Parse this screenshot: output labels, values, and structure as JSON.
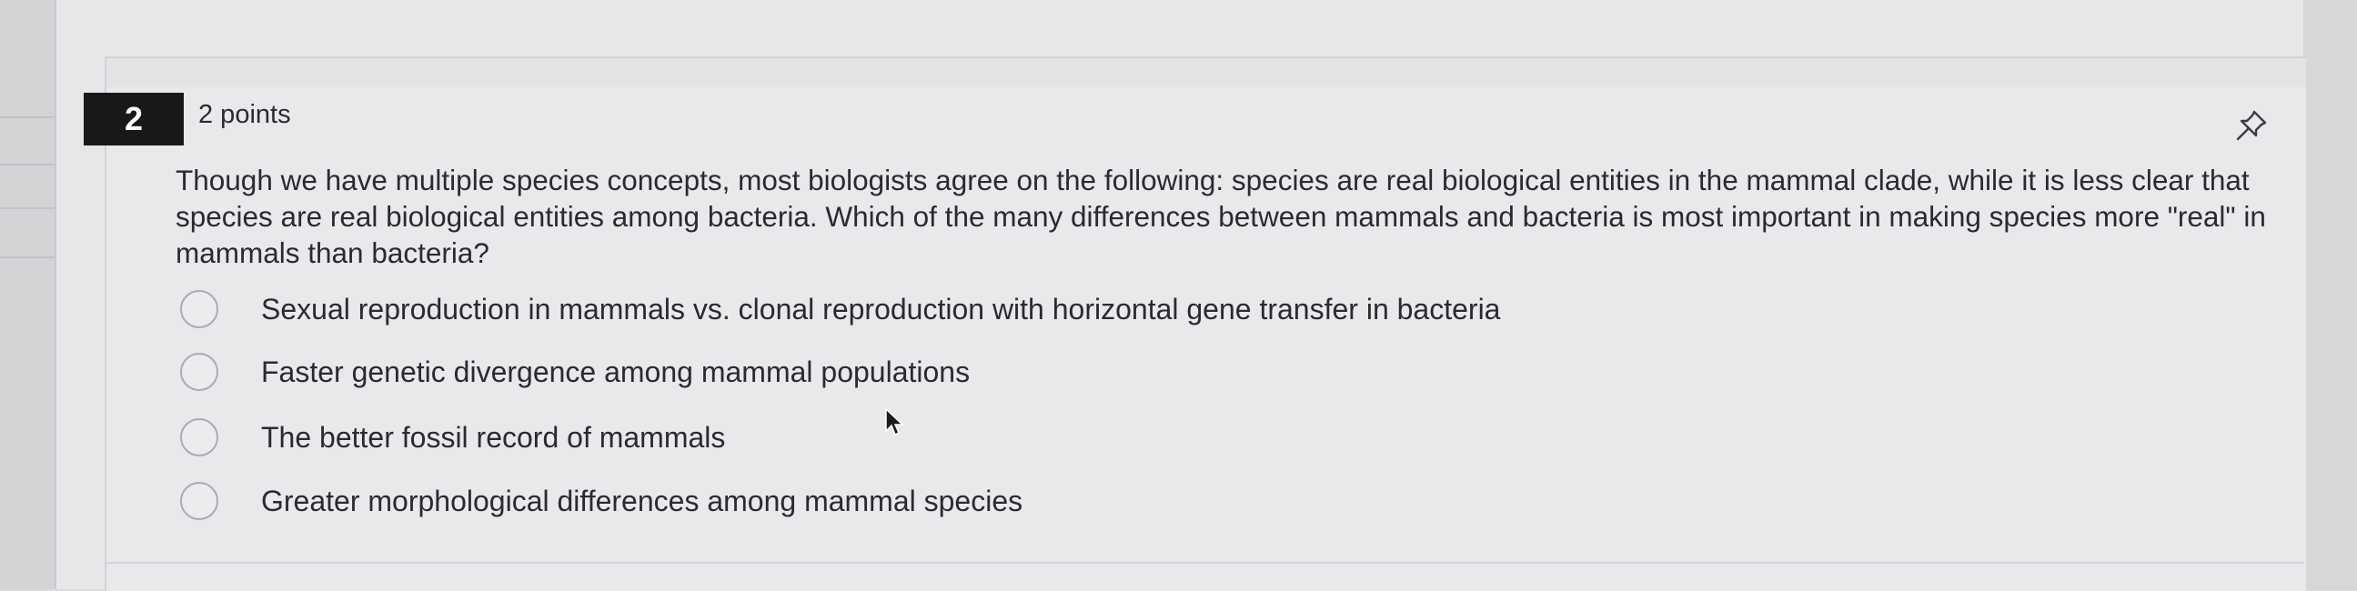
{
  "question": {
    "number": "2",
    "points": "2 points",
    "text": "Though we have multiple species concepts, most biologists agree on the following: species are real biological entities in the mammal clade, while it is less clear that species are real biological entities among bacteria. Which of the many differences between mammals and bacteria is most important in making species more \"real\" in mammals than bacteria?",
    "pin_icon": "pin-icon",
    "options": [
      {
        "label": "Sexual reproduction in mammals vs. clonal reproduction with horizontal gene transfer in bacteria",
        "selected": false
      },
      {
        "label": "Faster genetic divergence among mammal populations",
        "selected": false
      },
      {
        "label": "The better fossil record of mammals",
        "selected": false
      },
      {
        "label": "Greater morphological differences among mammal species",
        "selected": false
      }
    ]
  },
  "colors": {
    "number_badge_bg": "#17181a",
    "text": "#2a2b2e",
    "radio_border": "#a9abaf"
  }
}
